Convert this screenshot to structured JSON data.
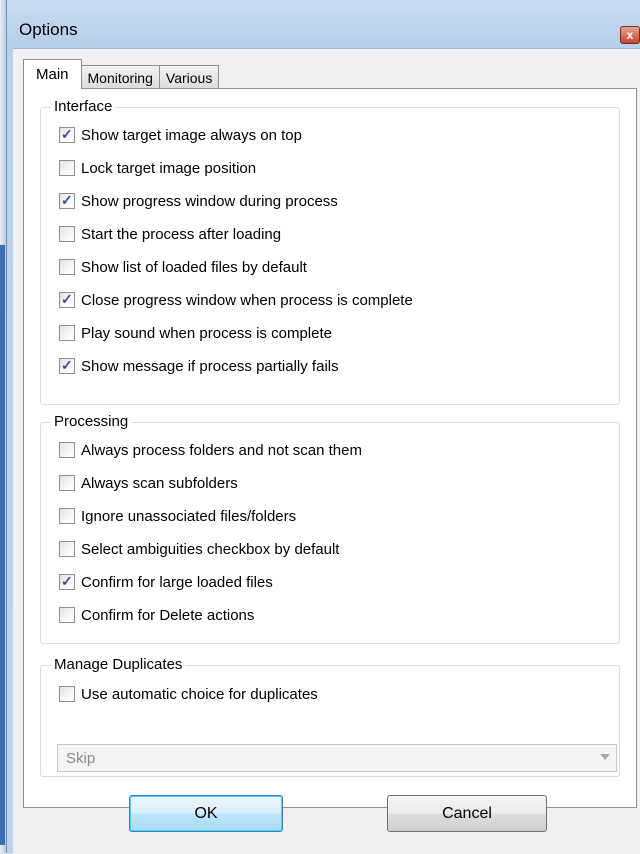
{
  "window": {
    "title": "Options"
  },
  "tabs": [
    {
      "label": "Main",
      "active": true
    },
    {
      "label": "Monitoring",
      "active": false
    },
    {
      "label": "Various",
      "active": false
    }
  ],
  "interface": {
    "legend": "Interface",
    "items": [
      {
        "label": "Show target image always on top",
        "checked": true
      },
      {
        "label": "Lock target image position",
        "checked": false
      },
      {
        "label": "Show progress window during process",
        "checked": true
      },
      {
        "label": "Start the process after loading",
        "checked": false
      },
      {
        "label": "Show list of loaded files by default",
        "checked": false
      },
      {
        "label": "Close progress window when process is complete",
        "checked": true
      },
      {
        "label": "Play sound when process is complete",
        "checked": false
      },
      {
        "label": "Show message if process partially fails",
        "checked": true
      }
    ]
  },
  "processing": {
    "legend": "Processing",
    "items": [
      {
        "label": "Always process folders and not scan them",
        "checked": false
      },
      {
        "label": "Always scan subfolders",
        "checked": false
      },
      {
        "label": "Ignore unassociated files/folders",
        "checked": false
      },
      {
        "label": "Select ambiguities checkbox by default",
        "checked": false
      },
      {
        "label": "Confirm for large loaded files",
        "checked": true
      },
      {
        "label": "Confirm for Delete actions",
        "checked": false
      }
    ]
  },
  "duplicates": {
    "legend": "Manage Duplicates",
    "auto_choice": {
      "label": "Use automatic choice for duplicates",
      "checked": false
    },
    "select_value": "Skip"
  },
  "buttons": {
    "ok": "OK",
    "cancel": "Cancel"
  },
  "check_glyph": "✓"
}
